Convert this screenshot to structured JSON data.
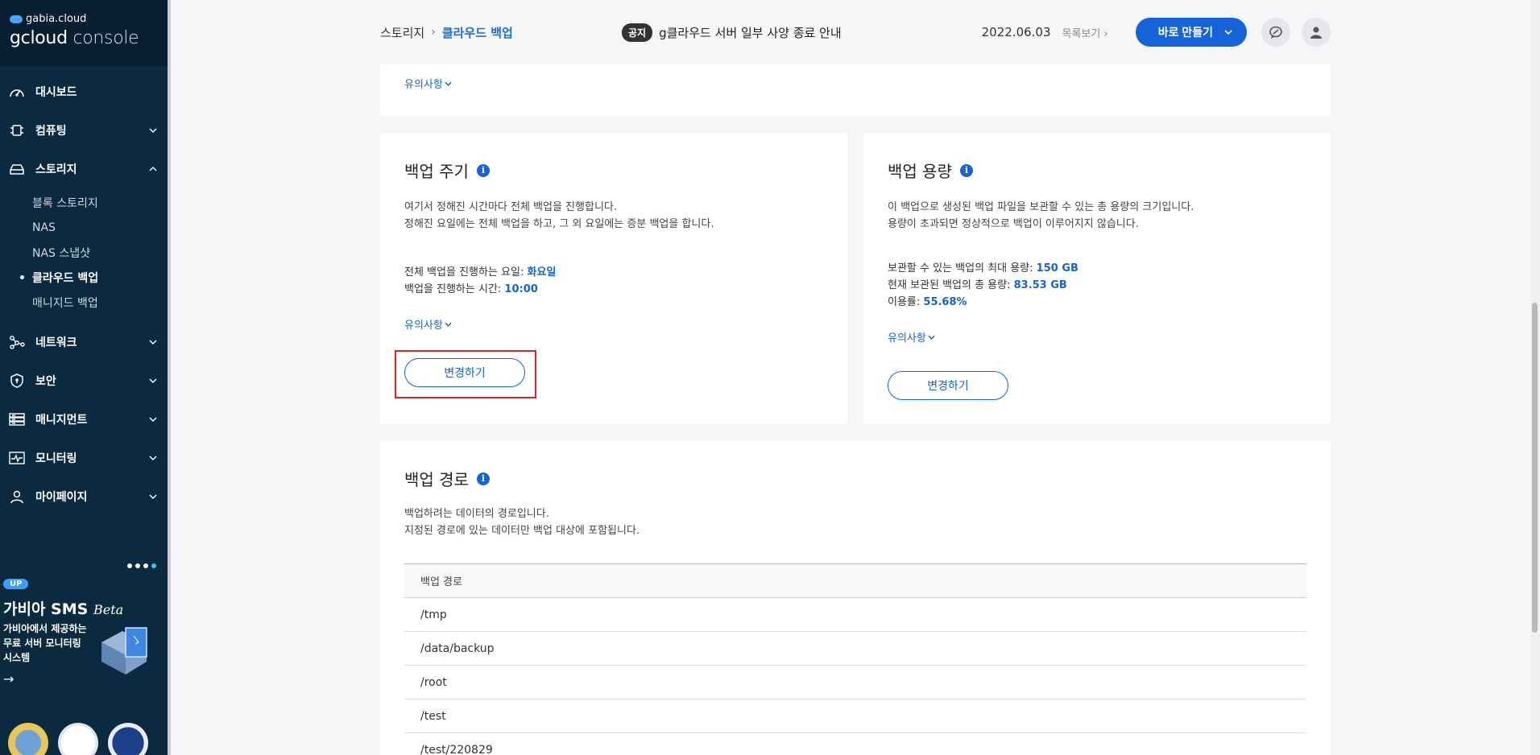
{
  "brand": {
    "top": "gabia.cloud",
    "console_a": "gcloud",
    "console_b": " console"
  },
  "sidebar": {
    "items": [
      {
        "label": "대시보드",
        "icon": "dashboard-icon"
      },
      {
        "label": "컴퓨팅",
        "icon": "chip-icon"
      },
      {
        "label": "스토리지",
        "icon": "storage-icon"
      },
      {
        "label": "네트워크",
        "icon": "network-icon"
      },
      {
        "label": "보안",
        "icon": "shield-icon"
      },
      {
        "label": "매니지먼트",
        "icon": "management-icon"
      },
      {
        "label": "모니터링",
        "icon": "monitoring-icon"
      },
      {
        "label": "마이페이지",
        "icon": "user-icon"
      }
    ],
    "storage_sub": [
      "블록 스토리지",
      "NAS",
      "NAS 스냅샷",
      "클라우드 백업",
      "매니지드 백업"
    ]
  },
  "promo": {
    "badge": "UP",
    "title": "가비아 SMS",
    "title_italic": "Beta",
    "desc_1": "가비아에서 제공하는",
    "desc_2": "무료 서버 모니터링",
    "desc_3": "시스템"
  },
  "header": {
    "breadcrumb_parent": "스토리지",
    "breadcrumb_sep": "›",
    "breadcrumb_current": "클라우드 백업",
    "notice_tag": "공지",
    "notice_text": "g클라우드 서버 일부 사양 종료 안내",
    "notice_date": "2022.06.03",
    "list_link": "목록보기",
    "create_label": "바로 만들기"
  },
  "warn_label": "유의사항",
  "cycle": {
    "title": "백업 주기",
    "desc_1": "여기서 정해진 시간마다 전체 백업을 진행합니다.",
    "desc_2": "정해진 요일에는 전체 백업을 하고, 그 외 요일에는 증분 백업을 합니다.",
    "day_label": "전체 백업을 진행하는 요일: ",
    "day_value": "화요일",
    "time_label": "백업을 진행하는 시간: ",
    "time_value": "10:00",
    "button": "변경하기"
  },
  "capacity": {
    "title": "백업 용량",
    "desc_1": "이 백업으로 생성된 백업 파일을 보관할 수 있는 총 용량의 크기입니다.",
    "desc_2": "용량이 초과되면 정상적으로 백업이 이루어지지 않습니다.",
    "max_label": "보관할 수 있는 백업의 최대 용량: ",
    "max_value": "150 GB",
    "used_label": "현재 보관된 백업의 총 용량: ",
    "used_value": "83.53 GB",
    "rate_label": "이용률: ",
    "rate_value": "55.68%",
    "button": "변경하기"
  },
  "path": {
    "title": "백업 경로",
    "desc_1": "백업하려는 데이터의 경로입니다.",
    "desc_2": "지정된 경로에 있는 데이터만 백업 대상에 포함됩니다.",
    "column": "백업 경로",
    "rows": [
      "/tmp",
      "/data/backup",
      "/root",
      "/test",
      "/test/220829"
    ]
  },
  "colors": {
    "sidebar_bg": "#0c2a3f",
    "accent": "#1563d6",
    "highlight": "#e02424"
  }
}
